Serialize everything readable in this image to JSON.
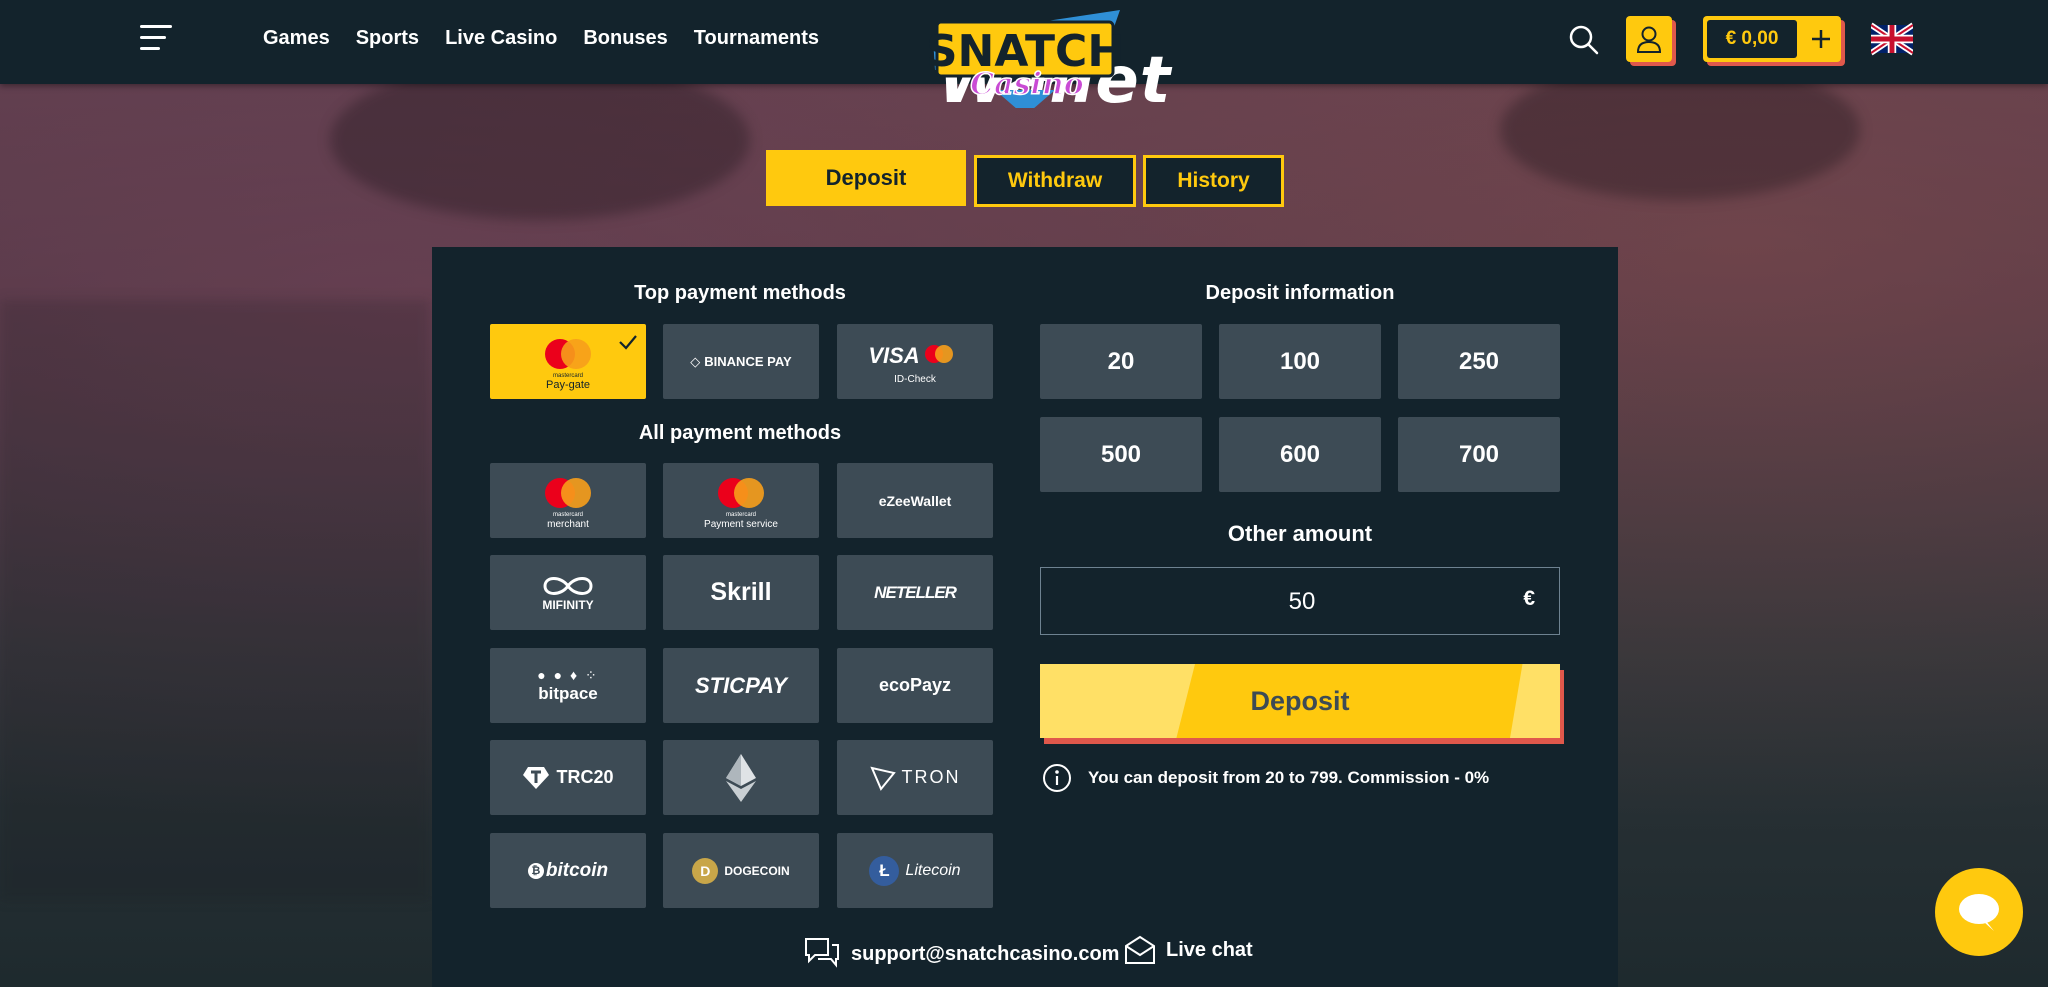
{
  "header": {
    "nav": [
      "Games",
      "Sports",
      "Live Casino",
      "Bonuses",
      "Tournaments"
    ],
    "logo_text_top": "SNATCH",
    "logo_text_bottom": "Casino",
    "balance": "€ 0,00",
    "colors": {
      "bar": "#13232c",
      "accent": "#ffc90e",
      "shadow": "#e0584b"
    }
  },
  "page": {
    "title": "Wallet"
  },
  "tabs": {
    "deposit": "Deposit",
    "withdraw": "Withdraw",
    "history": "History"
  },
  "payments": {
    "top_title": "Top payment methods",
    "top": [
      {
        "name": "mastercard-paygate",
        "caption_top": "mastercard",
        "caption": "Pay-gate",
        "selected": true
      },
      {
        "name": "binance-pay",
        "label": "BINANCE PAY"
      },
      {
        "name": "visa-mastercard-idcheck",
        "label": "VISA",
        "caption": "ID-Check"
      }
    ],
    "all_title": "All payment methods",
    "all": [
      {
        "name": "mastercard-merchant",
        "caption_top": "mastercard",
        "caption": "merchant"
      },
      {
        "name": "mastercard-payment-service",
        "caption_top": "mastercard",
        "caption": "Payment service"
      },
      {
        "name": "ezeewallet",
        "label": "eZeeWallet"
      },
      {
        "name": "mifinity",
        "label": "MIFINITY"
      },
      {
        "name": "skrill",
        "label": "Skrill"
      },
      {
        "name": "neteller",
        "label": "NETELLER"
      },
      {
        "name": "bitpace",
        "label": "bitpace"
      },
      {
        "name": "sticpay",
        "label": "STICPAY"
      },
      {
        "name": "ecopayz",
        "label": "ecoPayz"
      },
      {
        "name": "trc20",
        "label": "TRC20"
      },
      {
        "name": "ethereum",
        "label": ""
      },
      {
        "name": "tron",
        "label": "TRON"
      },
      {
        "name": "bitcoin",
        "label": "bitcoin"
      },
      {
        "name": "dogecoin",
        "label": "DOGECOIN"
      },
      {
        "name": "litecoin",
        "label": "Litecoin"
      }
    ]
  },
  "deposit": {
    "info_title": "Deposit information",
    "amounts": [
      "20",
      "100",
      "250",
      "500",
      "600",
      "700"
    ],
    "other_title": "Other amount",
    "other_value": "50",
    "currency": "€",
    "button": "Deposit",
    "info_text": "You can deposit from 20 to 799. Commission - 0%"
  },
  "footer": {
    "email": "support@snatchcasino.com",
    "live_chat": "Live chat"
  }
}
